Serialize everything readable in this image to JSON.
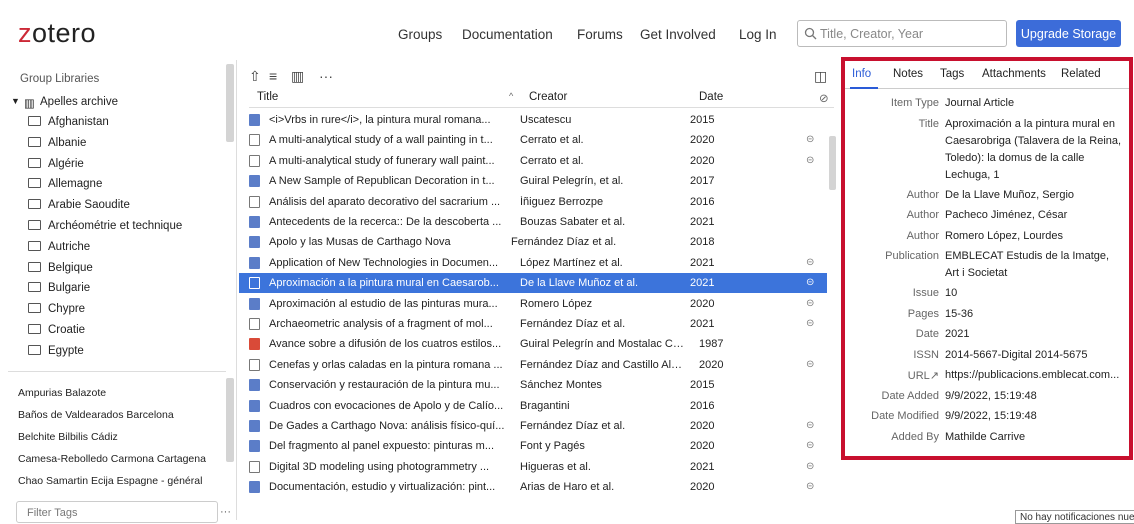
{
  "header": {
    "logo": "zotero",
    "nav": [
      "Groups",
      "Documentation",
      "Forums",
      "Get Involved",
      "Log In"
    ],
    "search_placeholder": "Title, Creator, Year",
    "upgrade_label": "Upgrade Storage"
  },
  "left": {
    "libraries_title": "Group Libraries",
    "group_name": "Apelles archive",
    "collections": [
      "Afghanistan",
      "Albanie",
      "Algérie",
      "Allemagne",
      "Arabie Saoudite",
      "Archéométrie et technique",
      "Autriche",
      "Belgique",
      "Bulgarie",
      "Chypre",
      "Croatie",
      "Egypte"
    ],
    "tags": [
      "Ampurias  Balazote",
      "Baños de Valdearados  Barcelona",
      "Belchite  Bilbilis  Cádiz",
      "Camesa-Rebolledo  Carmona  Cartagena",
      "Chao Samartin  Ecija  Espagne - général"
    ],
    "filter_placeholder": "Filter Tags",
    "more": "···"
  },
  "middle": {
    "columns": {
      "title": "Title",
      "creator": "Creator",
      "date": "Date"
    },
    "rows": [
      {
        "type": "journal",
        "title": "<i>Vrbs in rure</i>, la pintura mural romana...",
        "creator": "Uscatescu",
        "date": "2015",
        "att": ""
      },
      {
        "type": "doc",
        "title": "A multi-analytical study of a wall painting in t...",
        "creator": "Cerrato et al.",
        "date": "2020",
        "att": "⊝"
      },
      {
        "type": "doc",
        "title": "A multi-analytical study of funerary wall paint...",
        "creator": "Cerrato et al.",
        "date": "2020",
        "att": "⊝"
      },
      {
        "type": "journal",
        "title": "A New Sample of Republican Decoration in t...",
        "creator": "Guiral Pelegrín, et al.",
        "date": "2017",
        "att": ""
      },
      {
        "type": "doc",
        "title": "Análisis del aparato decorativo del sacrarium ...",
        "creator": "Íñiguez Berrozpe",
        "date": "2016",
        "att": ""
      },
      {
        "type": "journal",
        "title": "Antecedents de la recerca:: De la descoberta ...",
        "creator": "Bouzas Sabater et al.",
        "date": "2021",
        "att": ""
      },
      {
        "type": "journal",
        "title": "Apolo y las Musas de Carthago Nova",
        "creator": "Fernández Díaz et al.",
        "date": "2018",
        "att": ""
      },
      {
        "type": "journal",
        "title": "Application of New Technologies in Documen...",
        "creator": "López Martínez et al.",
        "date": "2021",
        "att": "⊝"
      },
      {
        "type": "doc",
        "title": "Aproximación a la pintura mural en Caesarob...",
        "creator": "De la Llave Muñoz et al.",
        "date": "2021",
        "att": "⊝",
        "selected": true
      },
      {
        "type": "journal",
        "title": "Aproximación al estudio de las pinturas mura...",
        "creator": "Romero López",
        "date": "2020",
        "att": "⊝"
      },
      {
        "type": "doc",
        "title": "Archaeometric analysis of a fragment of mol...",
        "creator": "Fernández Díaz et al.",
        "date": "2021",
        "att": "⊝"
      },
      {
        "type": "book",
        "title": "Avance sobre a difusión de los cuatros estilos...",
        "creator": "Guiral Pelegrín and Mostalac Cari...",
        "date": "1987",
        "att": ""
      },
      {
        "type": "doc",
        "title": "Cenefas y orlas caladas en la pintura romana ...",
        "creator": "Fernández Díaz and Castillo Alcá...",
        "date": "2020",
        "att": "⊝"
      },
      {
        "type": "journal",
        "title": "Conservación y restauración de la pintura mu...",
        "creator": "Sánchez Montes",
        "date": "2015",
        "att": ""
      },
      {
        "type": "journal",
        "title": "Cuadros con evocaciones de Apolo y de Calío...",
        "creator": "Bragantini",
        "date": "2016",
        "att": ""
      },
      {
        "type": "journal",
        "title": "De Gades a Carthago Nova: análisis físico-quí...",
        "creator": "Fernández Díaz et al.",
        "date": "2020",
        "att": "⊝"
      },
      {
        "type": "journal",
        "title": "Del fragmento al panel expuesto: pinturas m...",
        "creator": "Font y Pagés",
        "date": "2020",
        "att": "⊝"
      },
      {
        "type": "doc",
        "title": "Digital 3D modeling using photogrammetry ...",
        "creator": "Higueras et al.",
        "date": "2021",
        "att": "⊝"
      },
      {
        "type": "journal",
        "title": "Documentación, estudio y virtualización: pint...",
        "creator": "Arias de Haro et al.",
        "date": "2020",
        "att": "⊝"
      }
    ]
  },
  "right": {
    "tabs": [
      "Info",
      "Notes",
      "Tags",
      "Attachments",
      "Related"
    ],
    "fields": [
      {
        "label": "Item Type",
        "value": "Journal Article"
      },
      {
        "label": "Title",
        "value": "Aproximación a la pintura mural en Caesarobriga (Talavera de la Reina, Toledo): la domus de la calle Lechuga, 1"
      },
      {
        "label": "Author",
        "value": "De la Llave Muñoz, Sergio"
      },
      {
        "label": "Author",
        "value": "Pacheco Jiménez, César"
      },
      {
        "label": "Author",
        "value": "Romero López, Lourdes"
      },
      {
        "label": "Publication",
        "value": "EMBLECAT Estudis de la Imatge, Art i Societat"
      },
      {
        "label": "Issue",
        "value": "10"
      },
      {
        "label": "Pages",
        "value": "15-36"
      },
      {
        "label": "Date",
        "value": "2021"
      },
      {
        "label": "ISSN",
        "value": "2014-5667-Digital 2014-5675"
      },
      {
        "label": "URL↗",
        "value": "https://publicacions.emblecat.com..."
      },
      {
        "label": "Date Added",
        "value": "9/9/2022, 15:19:48"
      },
      {
        "label": "Date Modified",
        "value": "9/9/2022, 15:19:48"
      },
      {
        "label": "Added By",
        "value": "Mathilde Carrive"
      }
    ],
    "notice": "No hay notificaciones nuevas"
  },
  "colors": {
    "accent": "#3c6cd9",
    "selection": "#3c74db",
    "highlight_border": "#c8102e",
    "logo_z": "#cc2936"
  }
}
